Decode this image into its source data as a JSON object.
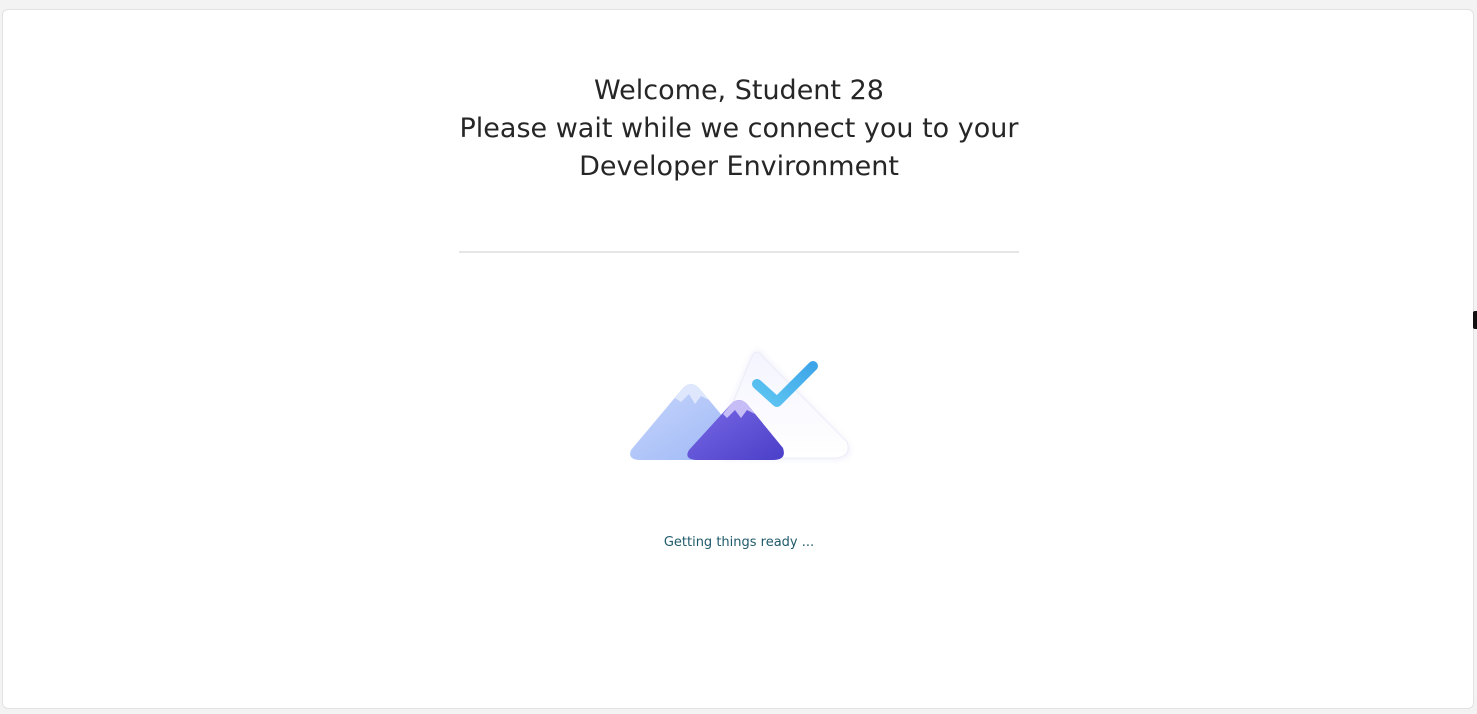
{
  "heading": {
    "line1": "Welcome, Student 28",
    "line2": "Please wait while we connect you to your",
    "line3": "Developer Environment"
  },
  "status": {
    "text": "Getting things ready ..."
  },
  "illustration": {
    "icon": "mountains-checkmark-icon"
  },
  "colors": {
    "heading": "#262626",
    "status": "#1f5a6b",
    "mountain_light": "#a9c3f7",
    "mountain_dark": "#5b4ed6",
    "check": "#4ab8ee"
  }
}
